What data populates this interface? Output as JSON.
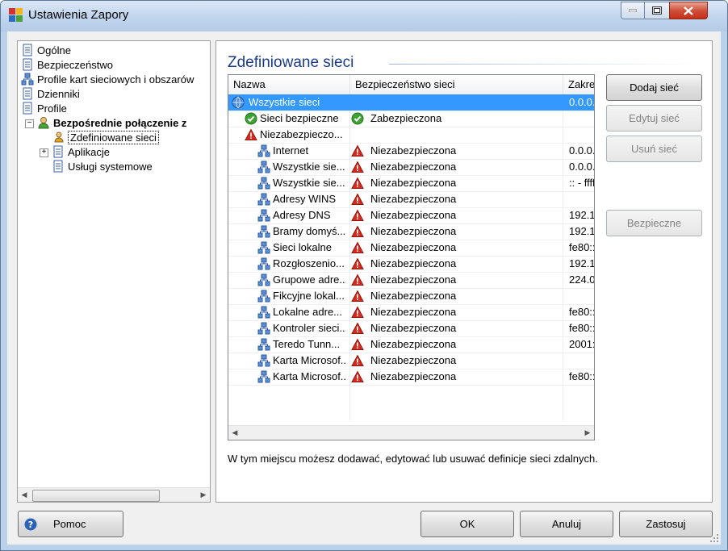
{
  "window": {
    "title": "Ustawienia Zapory"
  },
  "colors": {
    "accent": "#3399ff",
    "title_blue": "#1b3c8a",
    "ok_green": "#3ea235",
    "warn_red": "#d32b1e"
  },
  "tree": {
    "items": [
      {
        "label": "Ogólne",
        "icon": "page-icon"
      },
      {
        "label": "Bezpieczeństwo",
        "icon": "page-icon"
      },
      {
        "label": "Profile kart sieciowych i obszarów",
        "icon": "network-icon"
      },
      {
        "label": "Dzienniki",
        "icon": "page-icon"
      },
      {
        "label": "Profile",
        "icon": "page-icon"
      },
      {
        "label": "Bezpośrednie połączenie z",
        "icon": "user-icon"
      },
      {
        "label": "Zdefiniowane sieci",
        "icon": "user-network-icon"
      },
      {
        "label": "Aplikacje",
        "icon": "page-icon"
      },
      {
        "label": "Usługi systemowe",
        "icon": "page-icon"
      }
    ]
  },
  "panel": {
    "title": "Zdefiniowane sieci",
    "columns": [
      "Nazwa",
      "Bezpieczeństwo sieci",
      "Zakres"
    ],
    "rows": [
      {
        "name": "Wszystkie sieci",
        "security": "",
        "range": "0.0.0.",
        "icon": "globe-icon",
        "status": "none",
        "level": 0,
        "selected": true
      },
      {
        "name": "Sieci bezpieczne",
        "security": "Zabezpieczona",
        "range": "",
        "icon": "check-icon",
        "status": "ok",
        "level": 1
      },
      {
        "name": "Niezabezpieczo...",
        "security": "",
        "range": "",
        "icon": "warning-icon",
        "status": "none",
        "level": 1
      },
      {
        "name": "Internet",
        "security": "Niezabezpieczona",
        "range": "0.0.0.",
        "icon": "network-icon",
        "status": "warn",
        "level": 2
      },
      {
        "name": "Wszystkie sie...",
        "security": "Niezabezpieczona",
        "range": "0.0.0.",
        "icon": "network-icon",
        "status": "warn",
        "level": 2
      },
      {
        "name": "Wszystkie sie...",
        "security": "Niezabezpieczona",
        "range": ":: - ffff:",
        "icon": "network-icon",
        "status": "warn",
        "level": 2
      },
      {
        "name": "Adresy WINS",
        "security": "Niezabezpieczona",
        "range": "",
        "icon": "network-icon",
        "status": "warn",
        "level": 2
      },
      {
        "name": "Adresy DNS",
        "security": "Niezabezpieczona",
        "range": "192.1",
        "icon": "network-icon",
        "status": "warn",
        "level": 2
      },
      {
        "name": "Bramy domyś...",
        "security": "Niezabezpieczona",
        "range": "192.1",
        "icon": "network-icon",
        "status": "warn",
        "level": 2
      },
      {
        "name": "Sieci lokalne",
        "security": "Niezabezpieczona",
        "range": "fe80::",
        "icon": "network-icon",
        "status": "warn",
        "level": 2
      },
      {
        "name": "Rozgłoszenio...",
        "security": "Niezabezpieczona",
        "range": "192.1",
        "icon": "network-icon",
        "status": "warn",
        "level": 2
      },
      {
        "name": "Grupowe adre...",
        "security": "Niezabezpieczona",
        "range": "224.0",
        "icon": "network-icon",
        "status": "warn",
        "level": 2
      },
      {
        "name": "Fikcyjne lokal...",
        "security": "Niezabezpieczona",
        "range": "",
        "icon": "network-icon",
        "status": "warn",
        "level": 2
      },
      {
        "name": "Lokalne adre...",
        "security": "Niezabezpieczona",
        "range": "fe80::",
        "icon": "network-icon",
        "status": "warn",
        "level": 2
      },
      {
        "name": "Kontroler sieci...",
        "security": "Niezabezpieczona",
        "range": "fe80::",
        "icon": "network-icon",
        "status": "warn",
        "level": 2
      },
      {
        "name": "Teredo Tunn...",
        "security": "Niezabezpieczona",
        "range": "2001:",
        "icon": "network-icon",
        "status": "warn",
        "level": 2
      },
      {
        "name": "Karta Microsof...",
        "security": "Niezabezpieczona",
        "range": "",
        "icon": "network-icon",
        "status": "warn",
        "level": 2
      },
      {
        "name": "Karta Microsof...",
        "security": "Niezabezpieczona",
        "range": "fe80::",
        "icon": "network-icon",
        "status": "warn",
        "level": 2
      }
    ],
    "description": "W tym miejscu możesz dodawać, edytować lub usuwać definicje sieci zdalnych.",
    "buttons": {
      "add": "Dodaj sieć",
      "edit": "Edytuj sieć",
      "remove": "Usuń sieć",
      "safe": "Bezpieczne"
    }
  },
  "footer": {
    "help": "Pomoc",
    "ok": "OK",
    "cancel": "Anuluj",
    "apply": "Zastosuj"
  }
}
